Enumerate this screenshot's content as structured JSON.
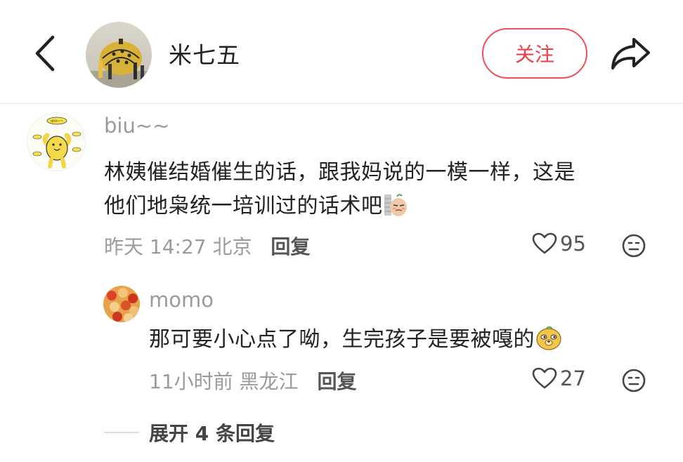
{
  "header": {
    "author_name": "米七五",
    "follow_label": "关注"
  },
  "comment": {
    "username": "biu~~",
    "text_line1": "林姨催结婚催生的话，跟我妈说的一模一样，这是",
    "text_line2": "他们地枭统一培训过的话术吧",
    "time": "昨天 14:27",
    "location": "北京",
    "reply_label": "回复",
    "likes": "95",
    "avatar_sticker_text": "ohh~~"
  },
  "reply": {
    "username": "momo",
    "text": "那可要小心点了呦，生完孩子是要被嘎的",
    "time": "11小时前",
    "location": "黑龙江",
    "reply_label": "回复",
    "likes": "27"
  },
  "expand_replies": {
    "label": "展开 4 条回复"
  },
  "colors": {
    "accent": "#ef3e4b",
    "meta_gray": "#9b9b9b",
    "text": "#222222"
  }
}
